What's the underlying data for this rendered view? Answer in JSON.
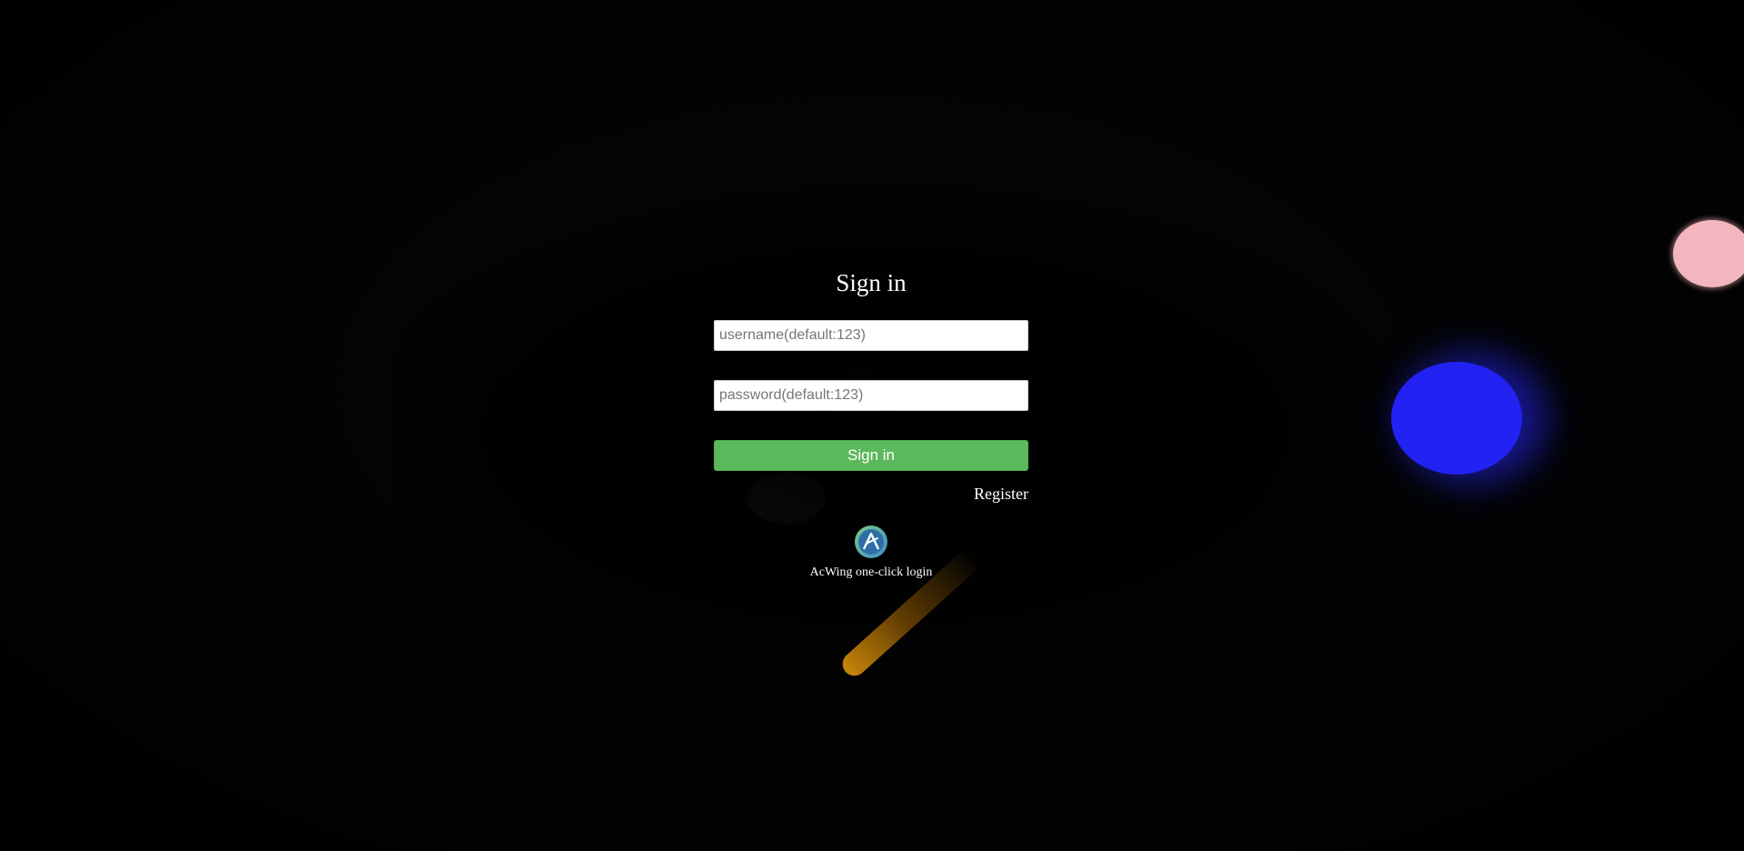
{
  "login": {
    "title": "Sign in",
    "username": {
      "value": "",
      "placeholder": "username(default:123)"
    },
    "password": {
      "value": "",
      "placeholder": "password(default:123)"
    },
    "submit_label": "Sign in",
    "register_label": "Register",
    "oauth": {
      "icon": "acwing-logo-icon",
      "label": "AcWing one-click login"
    }
  },
  "colors": {
    "page_background": "#000000",
    "submit_button": "#5cb85c",
    "text": "#ffffff"
  }
}
